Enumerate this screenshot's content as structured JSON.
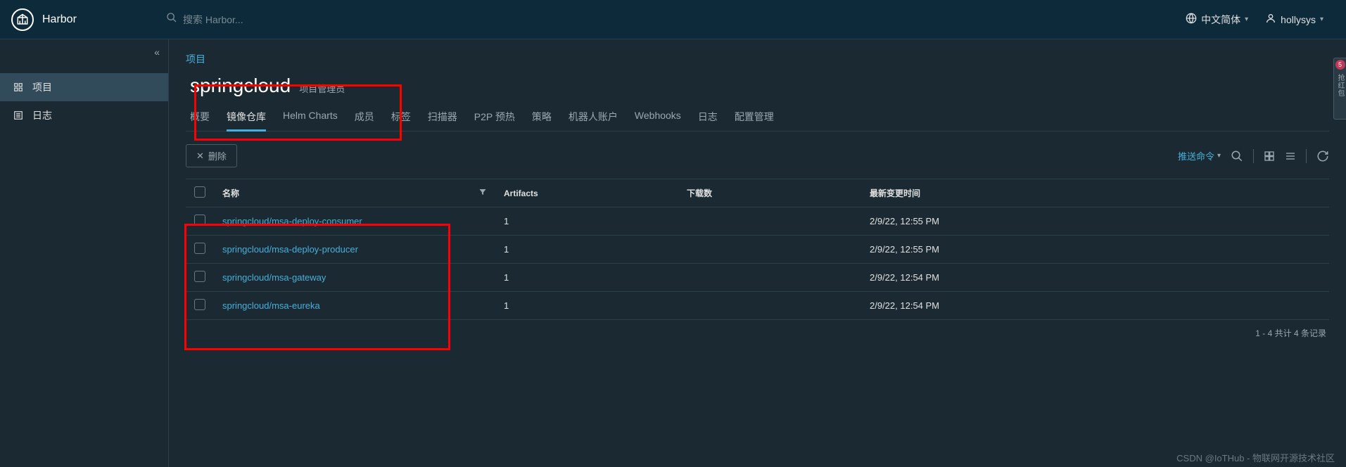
{
  "header": {
    "brand": "Harbor",
    "search_placeholder": "搜索 Harbor...",
    "language": "中文简体",
    "username": "hollysys"
  },
  "sidebar": {
    "items": [
      {
        "label": "项目",
        "icon": "grid-icon",
        "active": true
      },
      {
        "label": "日志",
        "icon": "list-icon",
        "active": false
      }
    ]
  },
  "breadcrumb": "项目",
  "project": {
    "name": "springcloud",
    "role": "项目管理员"
  },
  "tabs": [
    {
      "label": "概要",
      "active": false
    },
    {
      "label": "镜像仓库",
      "active": true
    },
    {
      "label": "Helm Charts",
      "active": false
    },
    {
      "label": "成员",
      "active": false
    },
    {
      "label": "标签",
      "active": false
    },
    {
      "label": "扫描器",
      "active": false
    },
    {
      "label": "P2P 预热",
      "active": false
    },
    {
      "label": "策略",
      "active": false
    },
    {
      "label": "机器人账户",
      "active": false
    },
    {
      "label": "Webhooks",
      "active": false
    },
    {
      "label": "日志",
      "active": false
    },
    {
      "label": "配置管理",
      "active": false
    }
  ],
  "toolbar": {
    "delete_label": "删除",
    "push_command_label": "推送命令"
  },
  "table": {
    "headers": {
      "name": "名称",
      "artifacts": "Artifacts",
      "downloads": "下载数",
      "updated": "最新变更时间"
    },
    "rows": [
      {
        "name": "springcloud/msa-deploy-consumer",
        "artifacts": "1",
        "downloads": "",
        "updated": "2/9/22, 12:55 PM"
      },
      {
        "name": "springcloud/msa-deploy-producer",
        "artifacts": "1",
        "downloads": "",
        "updated": "2/9/22, 12:55 PM"
      },
      {
        "name": "springcloud/msa-gateway",
        "artifacts": "1",
        "downloads": "",
        "updated": "2/9/22, 12:54 PM"
      },
      {
        "name": "springcloud/msa-eureka",
        "artifacts": "1",
        "downloads": "",
        "updated": "2/9/22, 12:54 PM"
      }
    ]
  },
  "pagination": "1 - 4 共计 4 条记录",
  "watermark": "CSDN @IoTHub - 物联网开源技术社区",
  "side_widget": {
    "badge": "5",
    "text": "抢红包"
  }
}
